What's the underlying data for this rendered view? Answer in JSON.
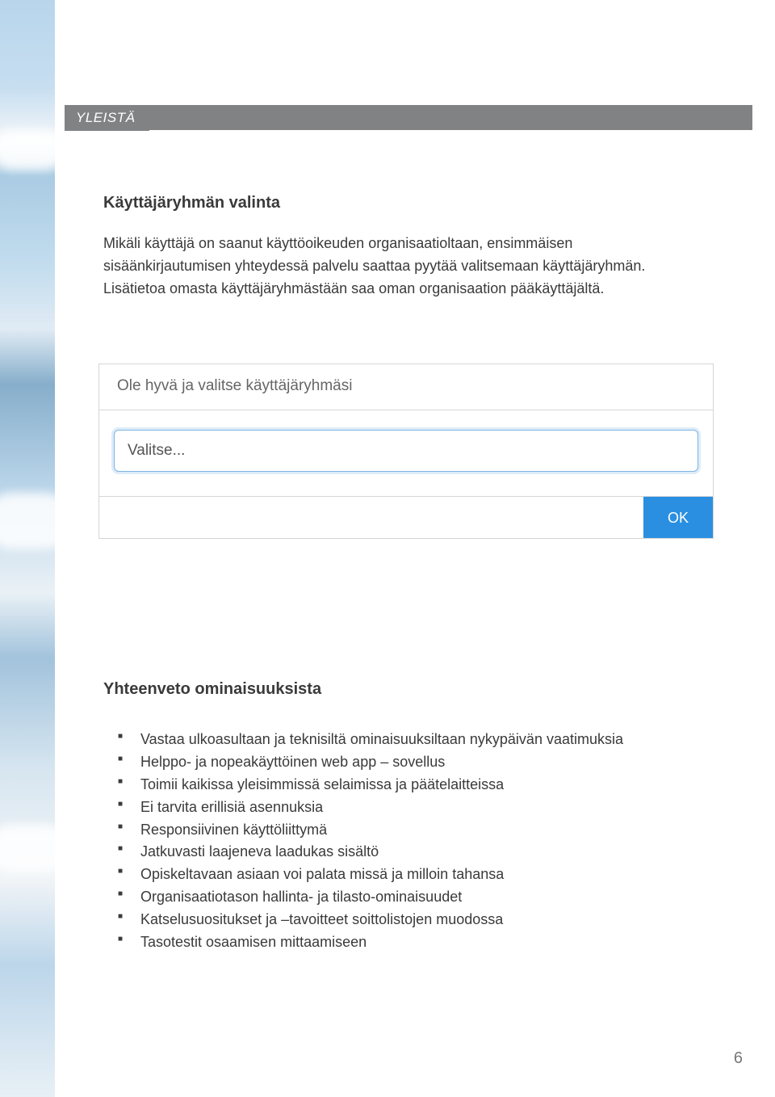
{
  "section_label": "YLEISTÄ",
  "heading1": "Käyttäjäryhmän valinta",
  "paragraph": "Mikäli käyttäjä on saanut käyttöoikeuden organisaatioltaan, ensimmäisen sisäänkirjautumisen yhteydessä palvelu saattaa pyytää valitsemaan käyttäjäryhmän. Lisätietoa omasta käyttäjäryhmästään saa oman organisaation pääkäyttäjältä.",
  "dialog": {
    "title": "Ole hyvä ja valitse käyttäjäryhmäsi",
    "select_placeholder": "Valitse...",
    "ok_label": "OK"
  },
  "heading2": "Yhteenveto ominaisuuksista",
  "features": [
    "Vastaa ulkoasultaan ja teknisiltä ominaisuuksiltaan nykypäivän vaatimuksia",
    "Helppo- ja nopeakäyttöinen web app – sovellus",
    "Toimii kaikissa yleisimmissä selaimissa ja päätelaitteissa",
    "Ei tarvita erillisiä asennuksia",
    "Responsiivinen käyttöliittymä",
    "Jatkuvasti laajeneva laadukas sisältö",
    "Opiskeltavaan asiaan voi palata missä ja milloin tahansa",
    "Organisaatiotason hallinta- ja tilasto-ominaisuudet",
    "Katselusuositukset ja –tavoitteet soittolistojen muodossa",
    "Tasotestit osaamisen mittaamiseen"
  ],
  "page_number": "6"
}
